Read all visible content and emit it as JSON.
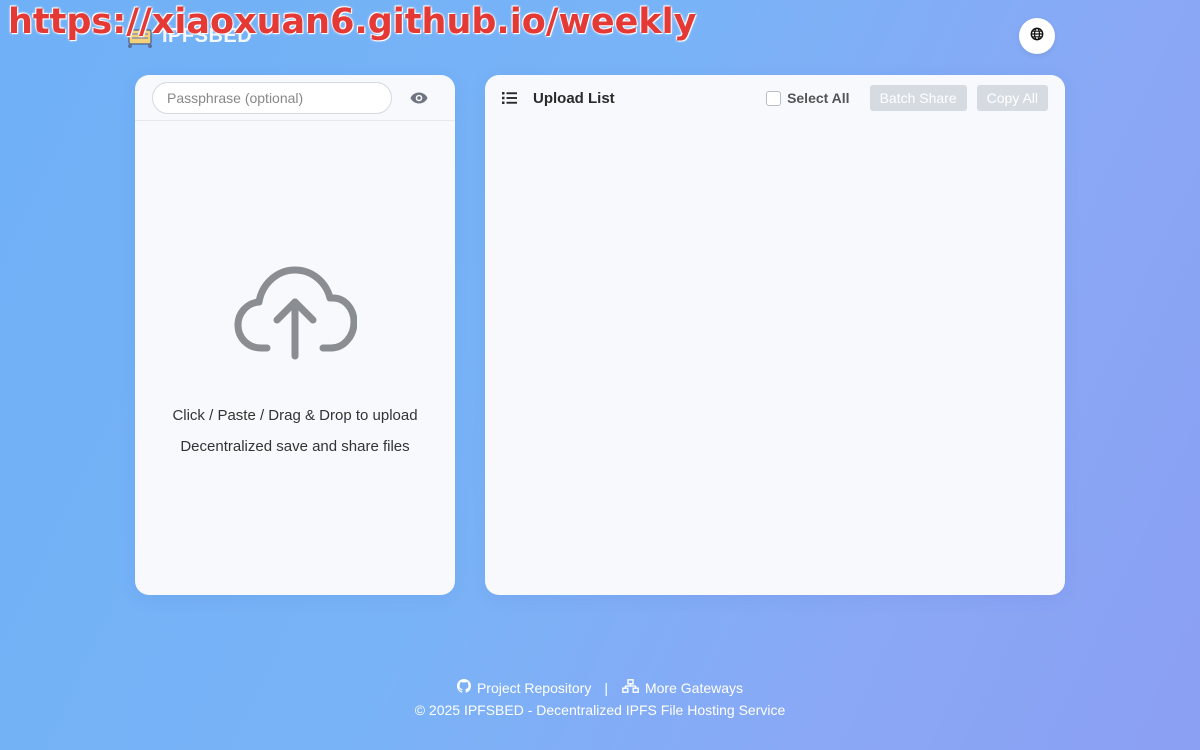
{
  "watermark": "https://xiaoxuan6.github.io/weekly",
  "brand": {
    "name": "IPFSBED",
    "logo_icon": "bed-logo-icon"
  },
  "header": {
    "language_icon": "globe-icon"
  },
  "upload_panel": {
    "passphrase_placeholder": "Passphrase (optional)",
    "passphrase_value": "",
    "visibility_icon": "eye-icon",
    "upload_icon": "cloud-upload-icon",
    "drop_text_line1": "Click / Paste / Drag & Drop to upload",
    "drop_text_line2": "Decentralized save and share files"
  },
  "list_panel": {
    "title_icon": "list-icon",
    "title": "Upload List",
    "select_all_label": "Select All",
    "select_all_checked": false,
    "batch_share_label": "Batch Share",
    "copy_all_label": "Copy All",
    "items": []
  },
  "footer": {
    "repo_icon": "github-icon",
    "repo_label": "Project Repository",
    "separator": "|",
    "gateways_icon": "network-icon",
    "gateways_label": "More Gateways",
    "copyright": "© 2025 IPFSBED - Decentralized IPFS File Hosting Service"
  },
  "colors": {
    "accent_red": "#e53935",
    "panel_bg": "#f7f9fc",
    "disabled_button": "#d6dbe2"
  }
}
